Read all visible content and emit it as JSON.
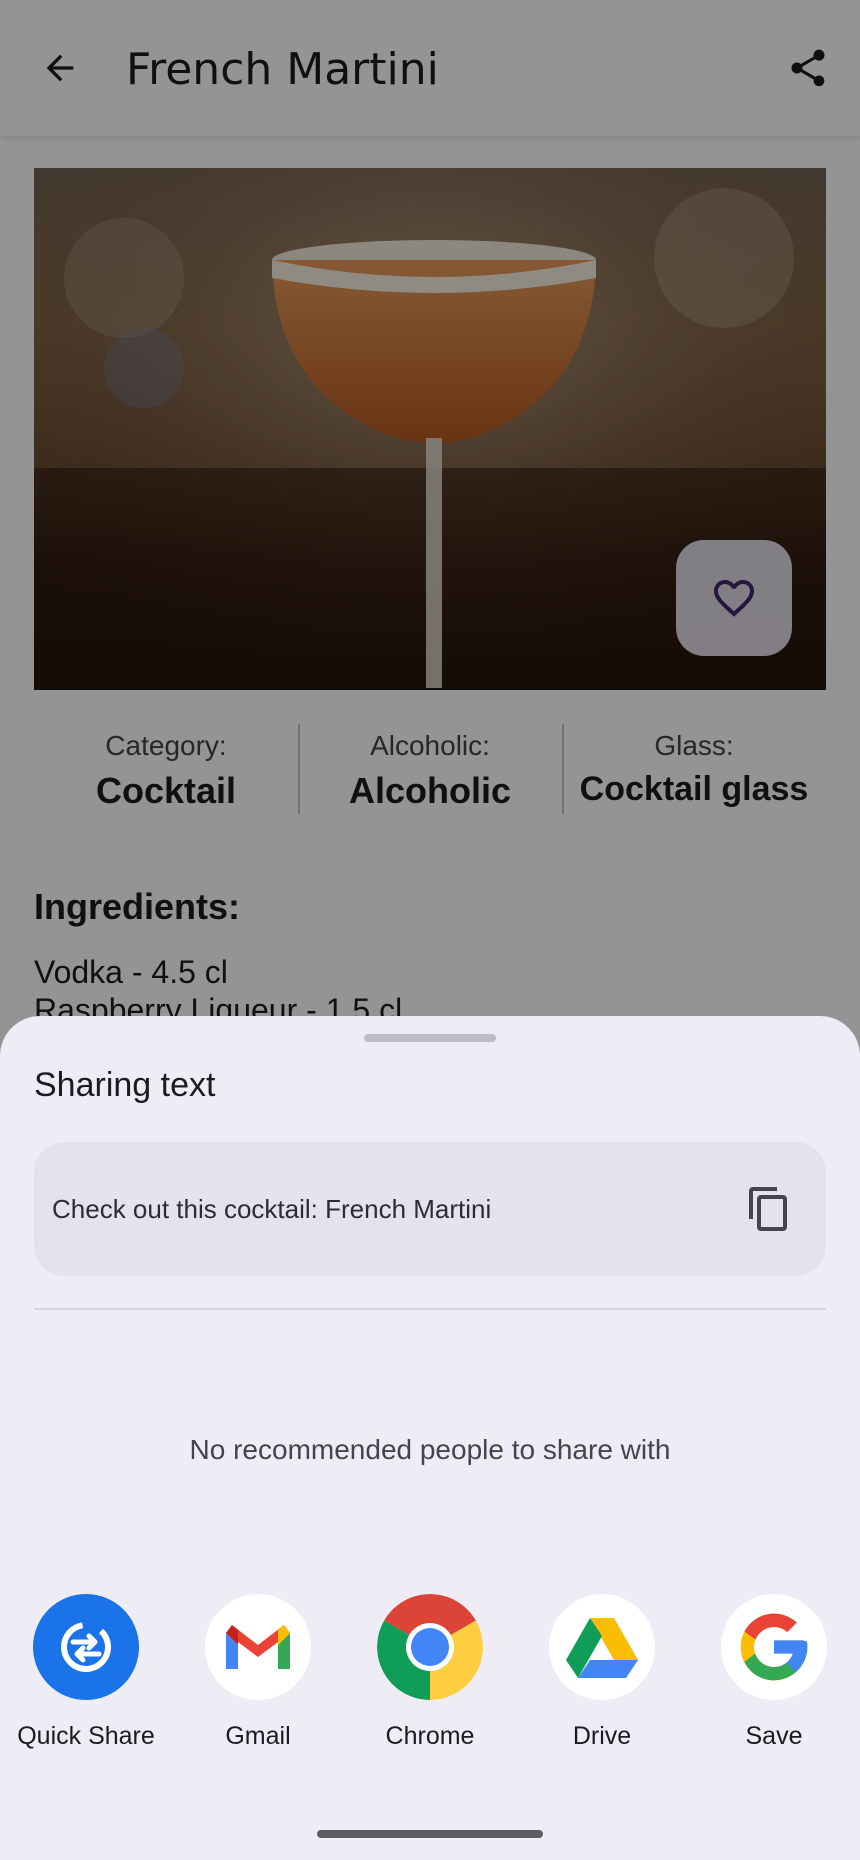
{
  "app": {
    "title": "French Martini",
    "info": [
      {
        "label": "Category:",
        "value": "Cocktail"
      },
      {
        "label": "Alcoholic:",
        "value": "Alcoholic"
      },
      {
        "label": "Glass:",
        "value": "Cocktail glass"
      }
    ],
    "ingredients_title": "Ingredients:",
    "ingredients": [
      "Vodka - 4.5 cl",
      "Raspberry Liqueur - 1.5 cl"
    ]
  },
  "share_sheet": {
    "title": "Sharing text",
    "preview_text": "Check out this cocktail: French Martini",
    "no_people_text": "No recommended people to share with",
    "apps": [
      {
        "label": "Quick Share",
        "icon": "quick-share-icon",
        "color": "#1a73e8"
      },
      {
        "label": "Gmail",
        "icon": "gmail-icon",
        "color": "#ea4335"
      },
      {
        "label": "Chrome",
        "icon": "chrome-icon",
        "color": "#4285f4"
      },
      {
        "label": "Drive",
        "icon": "drive-icon",
        "color": "#34a853"
      },
      {
        "label": "Save",
        "icon": "google-icon",
        "color": "#4285f4"
      }
    ]
  },
  "colors": {
    "sheet_bg": "#eeedf6",
    "accent": "#1a73e8"
  }
}
